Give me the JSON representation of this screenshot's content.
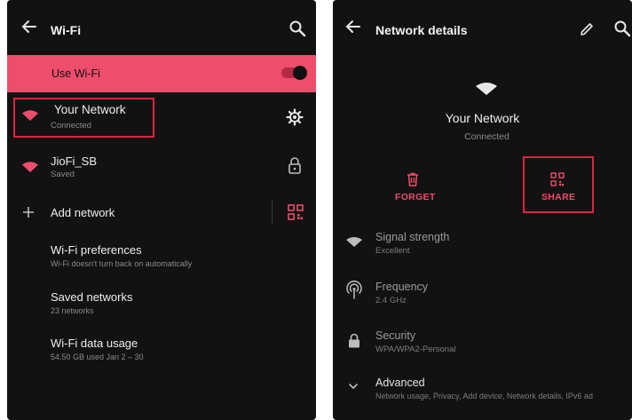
{
  "wifi_screen": {
    "title": "Wi-Fi",
    "use_wifi_label": "Use Wi-Fi",
    "networks": [
      {
        "name": "Your Network",
        "status": "Connected"
      },
      {
        "name": "JioFi_SB",
        "status": "Saved"
      }
    ],
    "add_network_label": "Add network",
    "settings": [
      {
        "label": "Wi-Fi preferences",
        "sub": "Wi-Fi doesn't turn back on automatically"
      },
      {
        "label": "Saved networks",
        "sub": "23 networks"
      },
      {
        "label": "Wi-Fi data usage",
        "sub": "54.50 GB used Jan 2 – 30"
      }
    ]
  },
  "details_screen": {
    "title": "Network details",
    "network_name": "Your Network",
    "status": "Connected",
    "forget_label": "FORGET",
    "share_label": "SHARE",
    "items": [
      {
        "label": "Signal strength",
        "value": "Excellent"
      },
      {
        "label": "Frequency",
        "value": "2.4 GHz"
      },
      {
        "label": "Security",
        "value": "WPA/WPA2-Personal"
      },
      {
        "label": "Advanced",
        "value": "Network usage, Privacy, Add device, Network details, IPv6 ad"
      }
    ]
  },
  "colors": {
    "background": "#121212",
    "accent": "#ee4d6b",
    "highlight_box": "#e0233f"
  }
}
